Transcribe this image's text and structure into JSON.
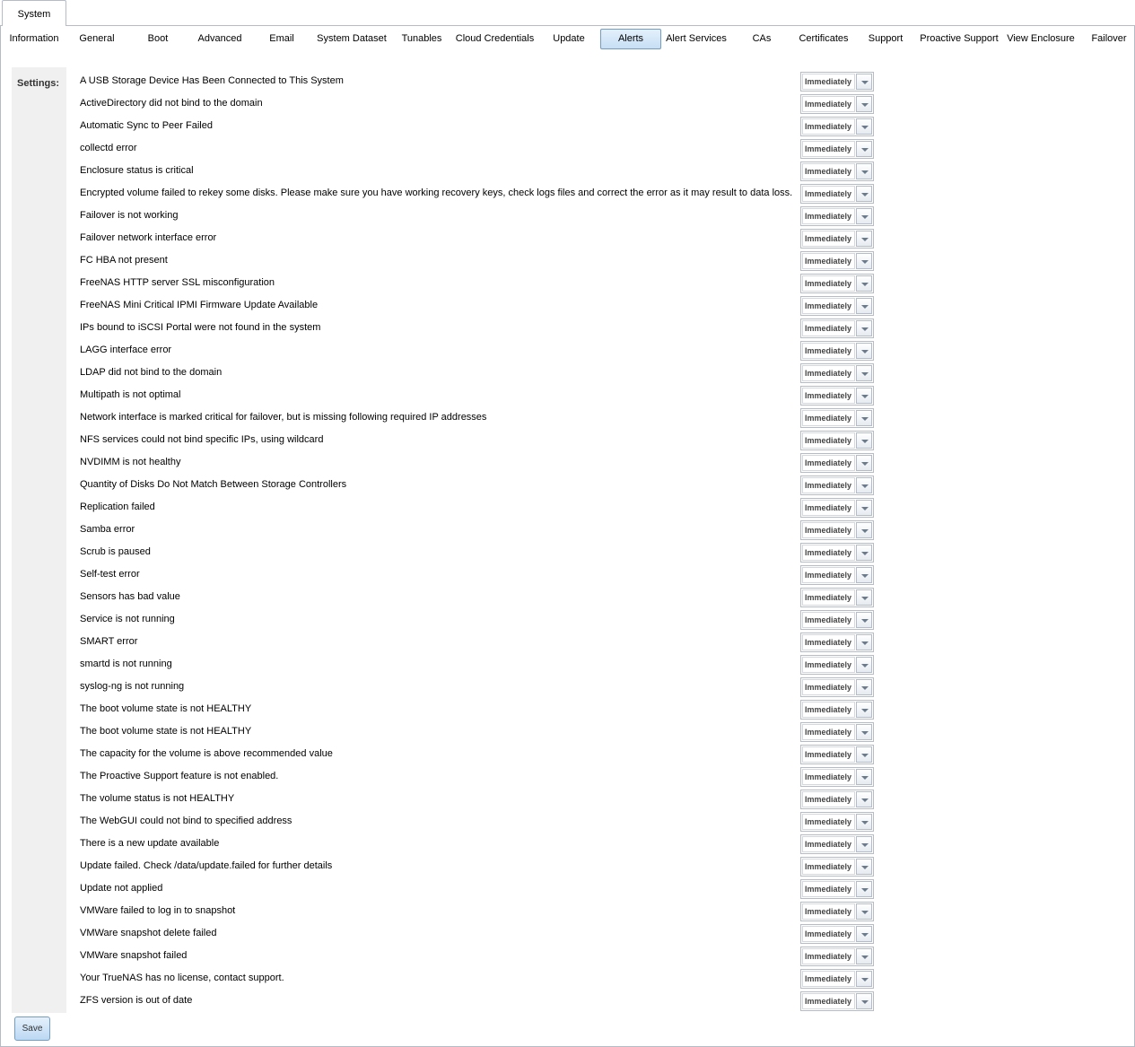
{
  "outer_tab": {
    "label": "System"
  },
  "tabs": [
    {
      "label": "Information",
      "active": false
    },
    {
      "label": "General",
      "active": false
    },
    {
      "label": "Boot",
      "active": false
    },
    {
      "label": "Advanced",
      "active": false
    },
    {
      "label": "Email",
      "active": false
    },
    {
      "label": "System Dataset",
      "active": false
    },
    {
      "label": "Tunables",
      "active": false
    },
    {
      "label": "Cloud Credentials",
      "active": false
    },
    {
      "label": "Update",
      "active": false
    },
    {
      "label": "Alerts",
      "active": true
    },
    {
      "label": "Alert Services",
      "active": false
    },
    {
      "label": "CAs",
      "active": false
    },
    {
      "label": "Certificates",
      "active": false
    },
    {
      "label": "Support",
      "active": false
    },
    {
      "label": "Proactive Support",
      "active": false
    },
    {
      "label": "View Enclosure",
      "active": false
    },
    {
      "label": "Failover",
      "active": false
    }
  ],
  "settings_label": "Settings:",
  "alerts": [
    {
      "label": "A USB Storage Device Has Been Connected to This System",
      "value": "Immediately"
    },
    {
      "label": "ActiveDirectory did not bind to the domain",
      "value": "Immediately"
    },
    {
      "label": "Automatic Sync to Peer Failed",
      "value": "Immediately"
    },
    {
      "label": "collectd error",
      "value": "Immediately"
    },
    {
      "label": "Enclosure status is critical",
      "value": "Immediately"
    },
    {
      "label": "Encrypted volume failed to rekey some disks. Please make sure you have working recovery keys, check logs files and correct the error as it may result to data loss.",
      "value": "Immediately"
    },
    {
      "label": "Failover is not working",
      "value": "Immediately"
    },
    {
      "label": "Failover network interface error",
      "value": "Immediately"
    },
    {
      "label": "FC HBA not present",
      "value": "Immediately"
    },
    {
      "label": "FreeNAS HTTP server SSL misconfiguration",
      "value": "Immediately"
    },
    {
      "label": "FreeNAS Mini Critical IPMI Firmware Update Available",
      "value": "Immediately"
    },
    {
      "label": "IPs bound to iSCSI Portal were not found in the system",
      "value": "Immediately"
    },
    {
      "label": "LAGG interface error",
      "value": "Immediately"
    },
    {
      "label": "LDAP did not bind to the domain",
      "value": "Immediately"
    },
    {
      "label": "Multipath is not optimal",
      "value": "Immediately"
    },
    {
      "label": "Network interface is marked critical for failover, but is missing following required IP addresses",
      "value": "Immediately"
    },
    {
      "label": "NFS services could not bind specific IPs, using wildcard",
      "value": "Immediately"
    },
    {
      "label": "NVDIMM is not healthy",
      "value": "Immediately"
    },
    {
      "label": "Quantity of Disks Do Not Match Between Storage Controllers",
      "value": "Immediately"
    },
    {
      "label": "Replication failed",
      "value": "Immediately"
    },
    {
      "label": "Samba error",
      "value": "Immediately"
    },
    {
      "label": "Scrub is paused",
      "value": "Immediately"
    },
    {
      "label": "Self-test error",
      "value": "Immediately"
    },
    {
      "label": "Sensors has bad value",
      "value": "Immediately"
    },
    {
      "label": "Service is not running",
      "value": "Immediately"
    },
    {
      "label": "SMART error",
      "value": "Immediately"
    },
    {
      "label": "smartd is not running",
      "value": "Immediately"
    },
    {
      "label": "syslog-ng is not running",
      "value": "Immediately"
    },
    {
      "label": "The boot volume state is not HEALTHY",
      "value": "Immediately"
    },
    {
      "label": "The boot volume state is not HEALTHY",
      "value": "Immediately"
    },
    {
      "label": "The capacity for the volume is above recommended value",
      "value": "Immediately"
    },
    {
      "label": "The Proactive Support feature is not enabled.",
      "value": "Immediately"
    },
    {
      "label": "The volume status is not HEALTHY",
      "value": "Immediately"
    },
    {
      "label": "The WebGUI could not bind to specified address",
      "value": "Immediately"
    },
    {
      "label": "There is a new update available",
      "value": "Immediately"
    },
    {
      "label": "Update failed. Check /data/update.failed for further details",
      "value": "Immediately"
    },
    {
      "label": "Update not applied",
      "value": "Immediately"
    },
    {
      "label": "VMWare failed to log in to snapshot",
      "value": "Immediately"
    },
    {
      "label": "VMWare snapshot delete failed",
      "value": "Immediately"
    },
    {
      "label": "VMWare snapshot failed",
      "value": "Immediately"
    },
    {
      "label": "Your TrueNAS has no license, contact support.",
      "value": "Immediately"
    },
    {
      "label": "ZFS version is out of date",
      "value": "Immediately"
    }
  ],
  "save_label": "Save",
  "colors": {
    "accent_border": "#759dc0",
    "active_tab_bg": "#c6dff5",
    "settings_panel_bg": "#f0f0f0"
  }
}
